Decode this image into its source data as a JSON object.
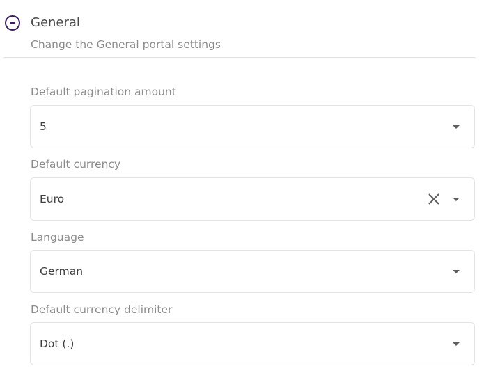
{
  "section": {
    "title": "General",
    "subtitle": "Change the General portal settings"
  },
  "fields": [
    {
      "label": "Default pagination amount",
      "value": "5",
      "clearable": false
    },
    {
      "label": "Default currency",
      "value": "Euro",
      "clearable": true
    },
    {
      "label": "Language",
      "value": "German",
      "clearable": false
    },
    {
      "label": "Default currency delimiter",
      "value": "Dot (.)",
      "clearable": false
    }
  ],
  "colors": {
    "accent": "#3b1f5e",
    "label": "#8c8c8c",
    "border": "#e3e3e3",
    "value": "#3e3e3e"
  },
  "icons": [
    "minus-circle-icon",
    "chevron-down-icon",
    "close-icon"
  ]
}
